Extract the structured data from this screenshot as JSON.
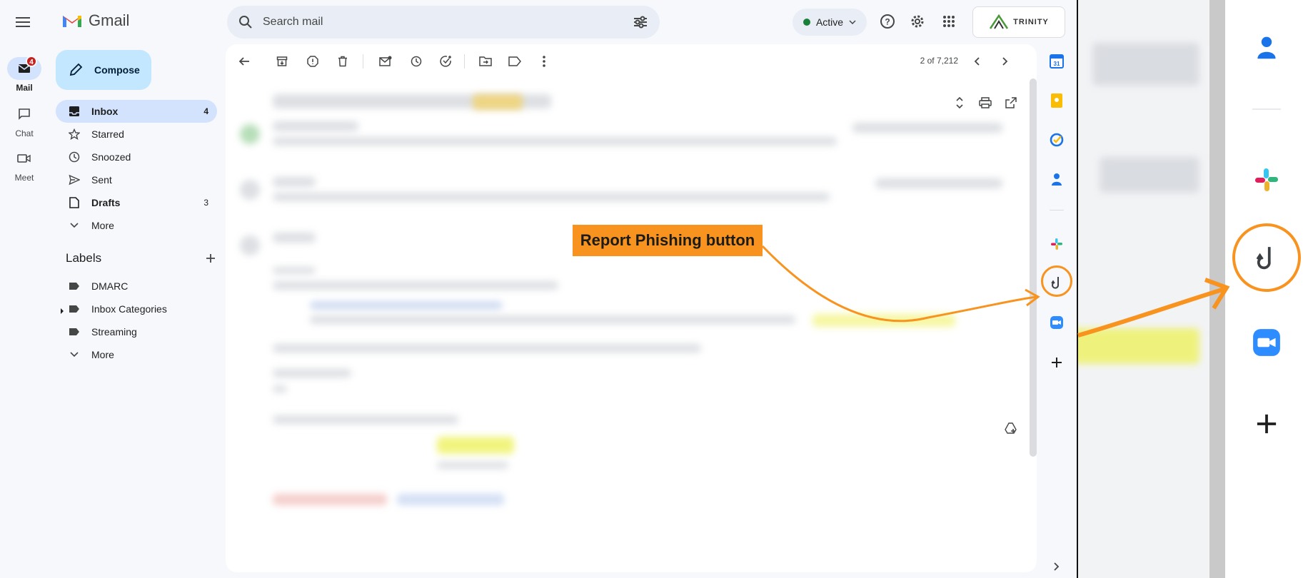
{
  "app": {
    "name": "Gmail"
  },
  "rail": {
    "mail": {
      "label": "Mail",
      "badge": "4"
    },
    "chat": {
      "label": "Chat"
    },
    "meet": {
      "label": "Meet"
    }
  },
  "search": {
    "placeholder": "Search mail"
  },
  "status": {
    "label": "Active"
  },
  "brand": {
    "text": "TRINITY"
  },
  "compose": {
    "label": "Compose"
  },
  "nav": {
    "items": [
      {
        "label": "Inbox",
        "count": "4",
        "icon": "inbox-icon"
      },
      {
        "label": "Starred",
        "count": "",
        "icon": "star-icon"
      },
      {
        "label": "Snoozed",
        "count": "",
        "icon": "clock-icon"
      },
      {
        "label": "Sent",
        "count": "",
        "icon": "send-icon"
      },
      {
        "label": "Drafts",
        "count": "3",
        "icon": "draft-icon"
      },
      {
        "label": "More",
        "count": "",
        "icon": "chevron-down-icon"
      }
    ]
  },
  "labels": {
    "heading": "Labels",
    "items": [
      {
        "label": "DMARC"
      },
      {
        "label": "Inbox Categories"
      },
      {
        "label": "Streaming"
      },
      {
        "label": "More"
      }
    ]
  },
  "pager": {
    "text": "2 of 7,212"
  },
  "callout": {
    "text": "Report Phishing button"
  },
  "colors": {
    "accent": "#f7931e",
    "compose": "#c2e7ff",
    "active_nav": "#d3e3fd",
    "badge": "#c5221f",
    "status_dot": "#188038"
  }
}
